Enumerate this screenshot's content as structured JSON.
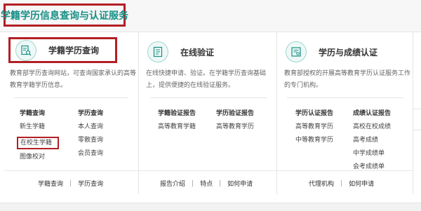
{
  "header": {
    "title": "学籍学历信息查询与认证服务"
  },
  "services": [
    {
      "icon": "student-record-search-icon",
      "title": "学籍学历查询",
      "desc": "教育部学历查询网站，可查询国家承认的高等教育学籍学历信息。",
      "groups": [
        {
          "title": "学籍查询",
          "items": [
            "新生学籍",
            "在校生学籍",
            "图像校对"
          ]
        },
        {
          "title": "学历查询",
          "items": [
            "本人查询",
            "零散查询",
            "会员查询"
          ]
        }
      ],
      "links": [
        "学籍查询",
        "学历查询"
      ]
    },
    {
      "icon": "online-verification-icon",
      "title": "在线验证",
      "desc": "在线快捷申请、验证。在学籍学历查询基础上，提供便捷的在线验证服务。",
      "groups": [
        {
          "title": "学籍验证报告",
          "items": [
            "高等教育学籍"
          ]
        },
        {
          "title": "学历验证报告",
          "items": [
            "高等教育学历"
          ]
        }
      ],
      "links": [
        "报告介绍",
        "特点",
        "如何申请"
      ]
    },
    {
      "icon": "certificate-icon",
      "title": "学历与成绩认证",
      "desc": "教育部授权的开展高等教育学历认证服务工作的专门机构。",
      "groups": [
        {
          "title": "学历认证报告",
          "items": [
            "高等教育学历",
            "中等教育学历"
          ]
        },
        {
          "title": "成绩认证报告",
          "items": [
            "高校在校成绩",
            "高考成绩",
            "中学成绩单",
            "会考成绩单"
          ]
        }
      ],
      "links": [
        "代理机构",
        "如何申请"
      ]
    }
  ],
  "colors": {
    "accent": "#178f86",
    "highlight": "#b21f24"
  }
}
